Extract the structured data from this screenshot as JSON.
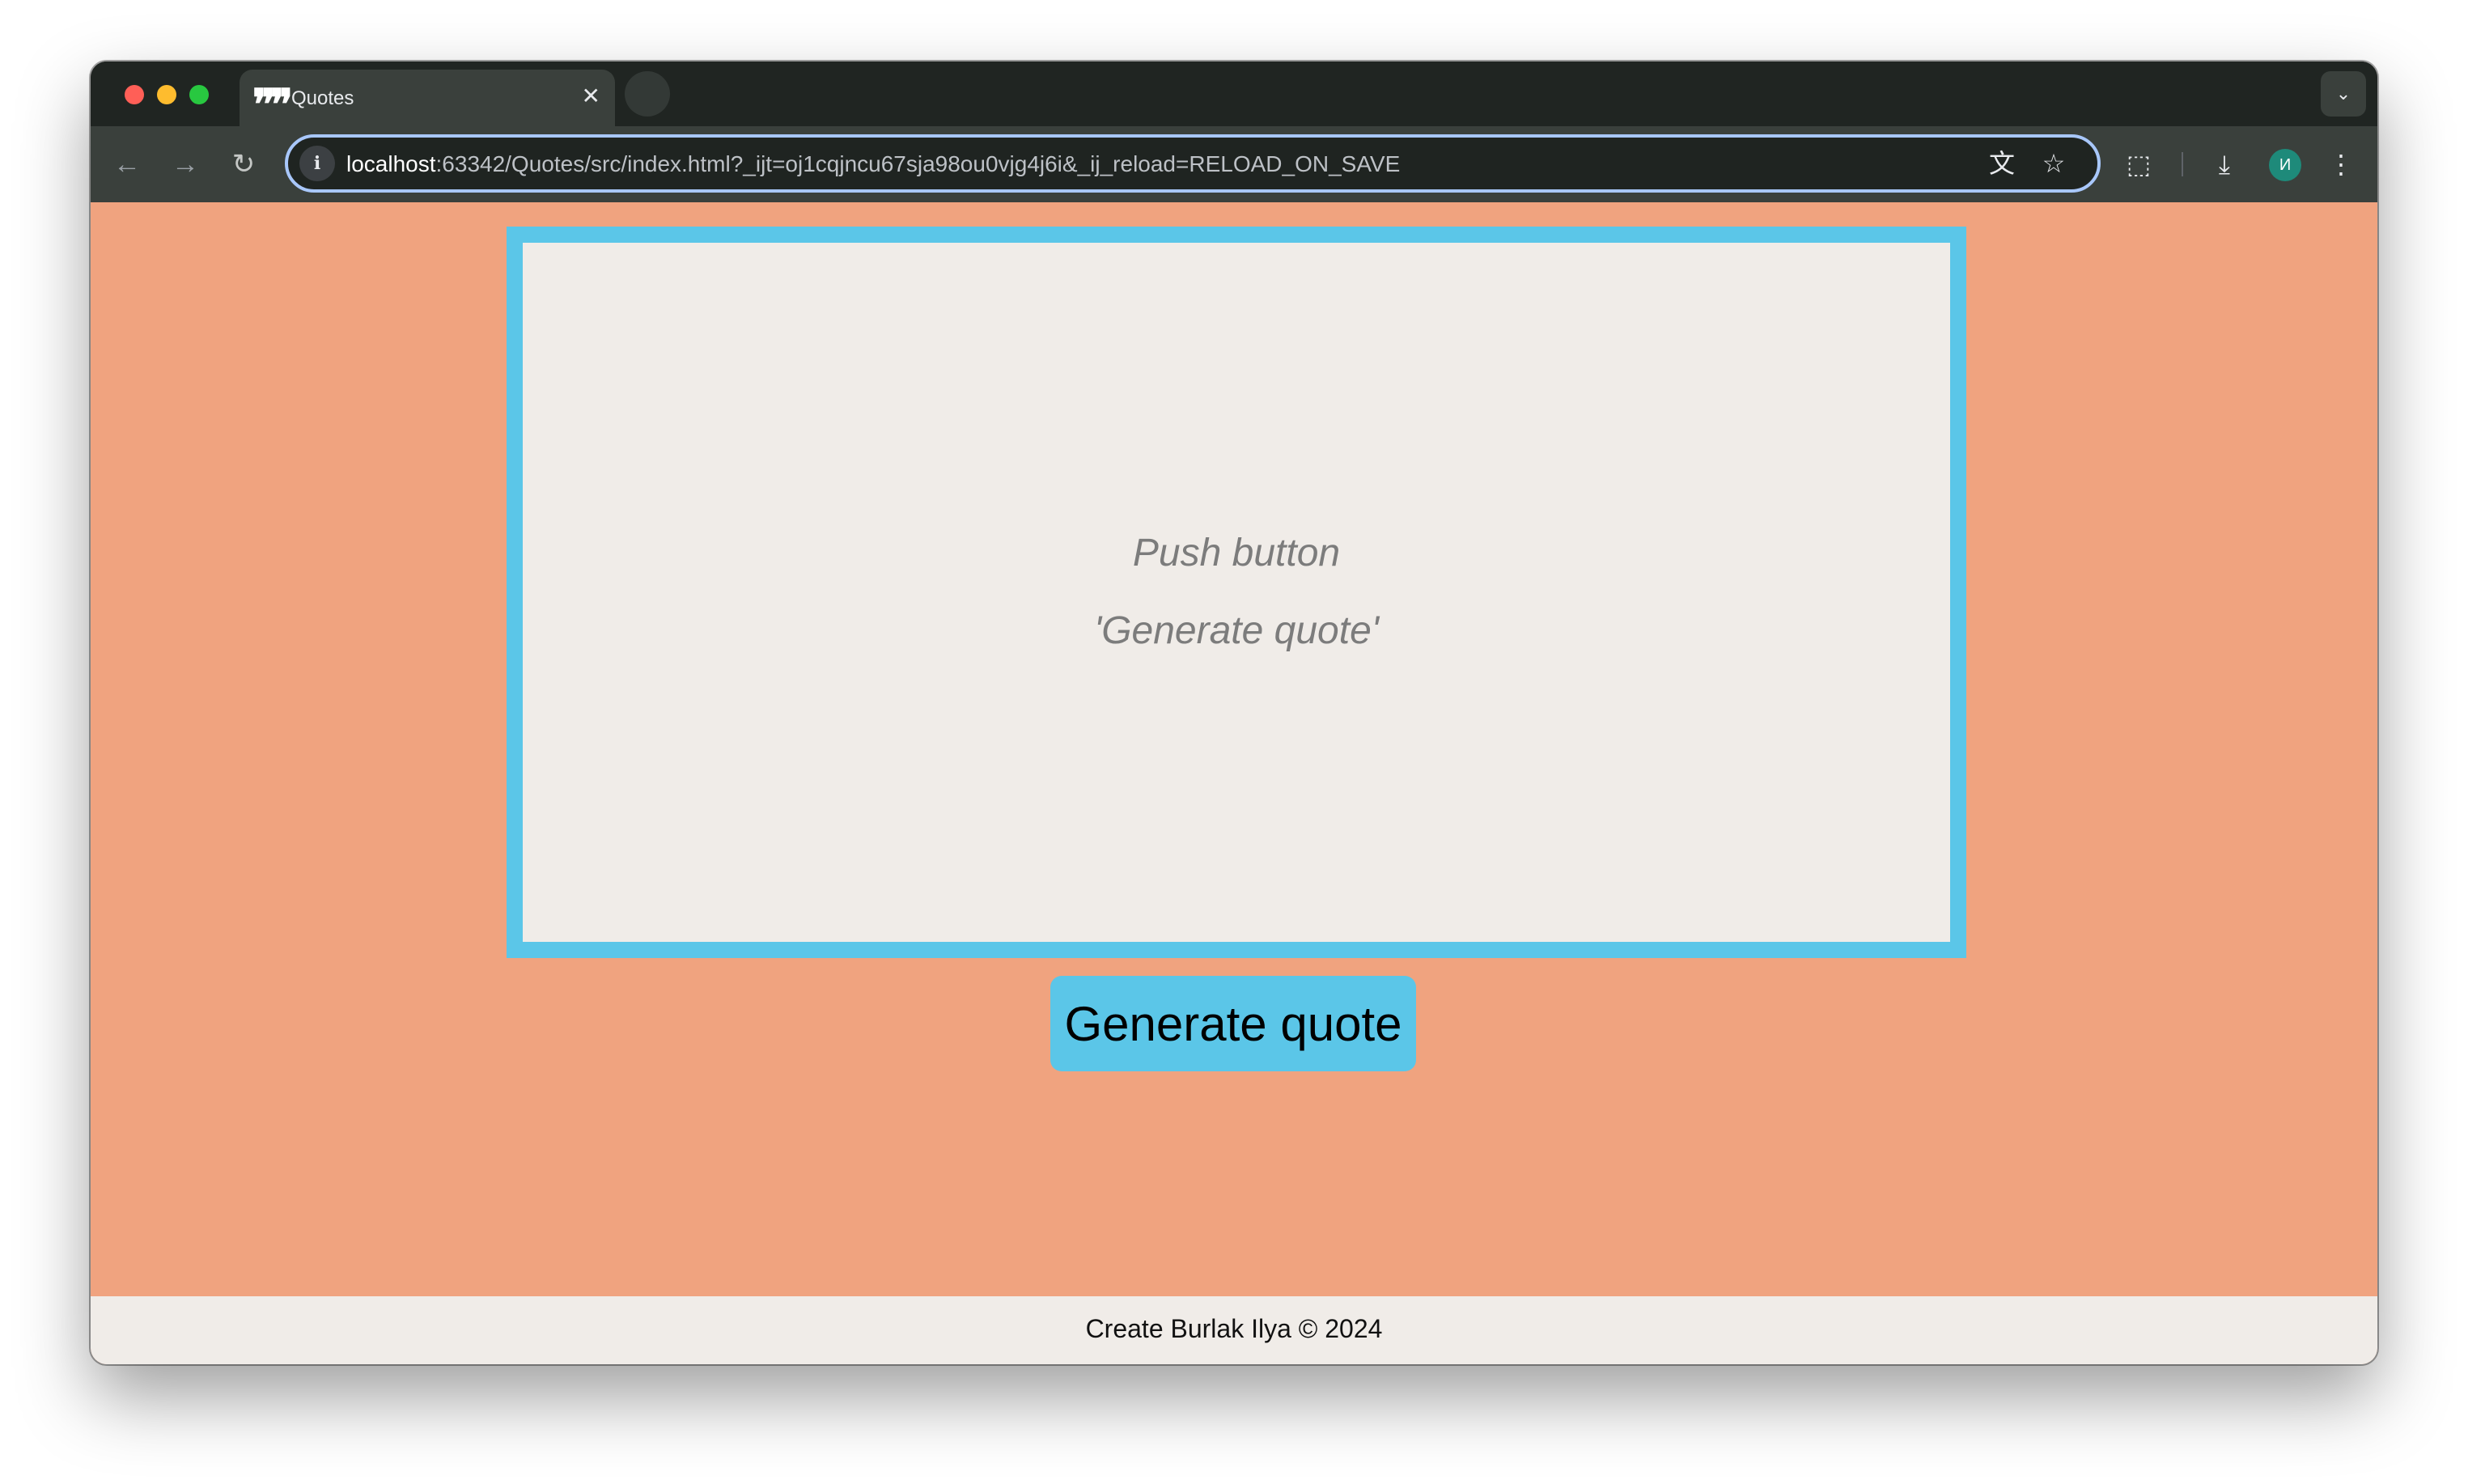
{
  "browser": {
    "tab": {
      "title": "Quotes",
      "favicon_glyph": "❞❞",
      "close_glyph": "✕"
    },
    "toolbar": {
      "back_glyph": "←",
      "forward_glyph": "→",
      "reload_glyph": "↻"
    },
    "address_bar": {
      "info_glyph": "i",
      "url_host": "localhost",
      "url_rest": ":63342/Quotes/src/index.html?_ijt=oj1cqjncu67sja98ou0vjg4j6i&_ij_reload=RELOAD_ON_SAVE",
      "translate_glyph": "文",
      "bookmark_glyph": "☆"
    },
    "extensions_glyph": "⬚",
    "download_glyph": "⤓",
    "profile_initial": "И",
    "menu_glyph": "⋮",
    "tab_search_glyph": "⌄"
  },
  "page": {
    "quote_box": {
      "line1": "Push button",
      "line2": "'Generate quote'"
    },
    "generate_button_label": "Generate quote",
    "footer_text": "Create Burlak Ilya © 2024"
  },
  "colors": {
    "page_background": "#f0a37f",
    "accent_blue": "#5bc6e8",
    "panel_background": "#f0ece8",
    "placeholder_text": "#7c7c7c"
  }
}
